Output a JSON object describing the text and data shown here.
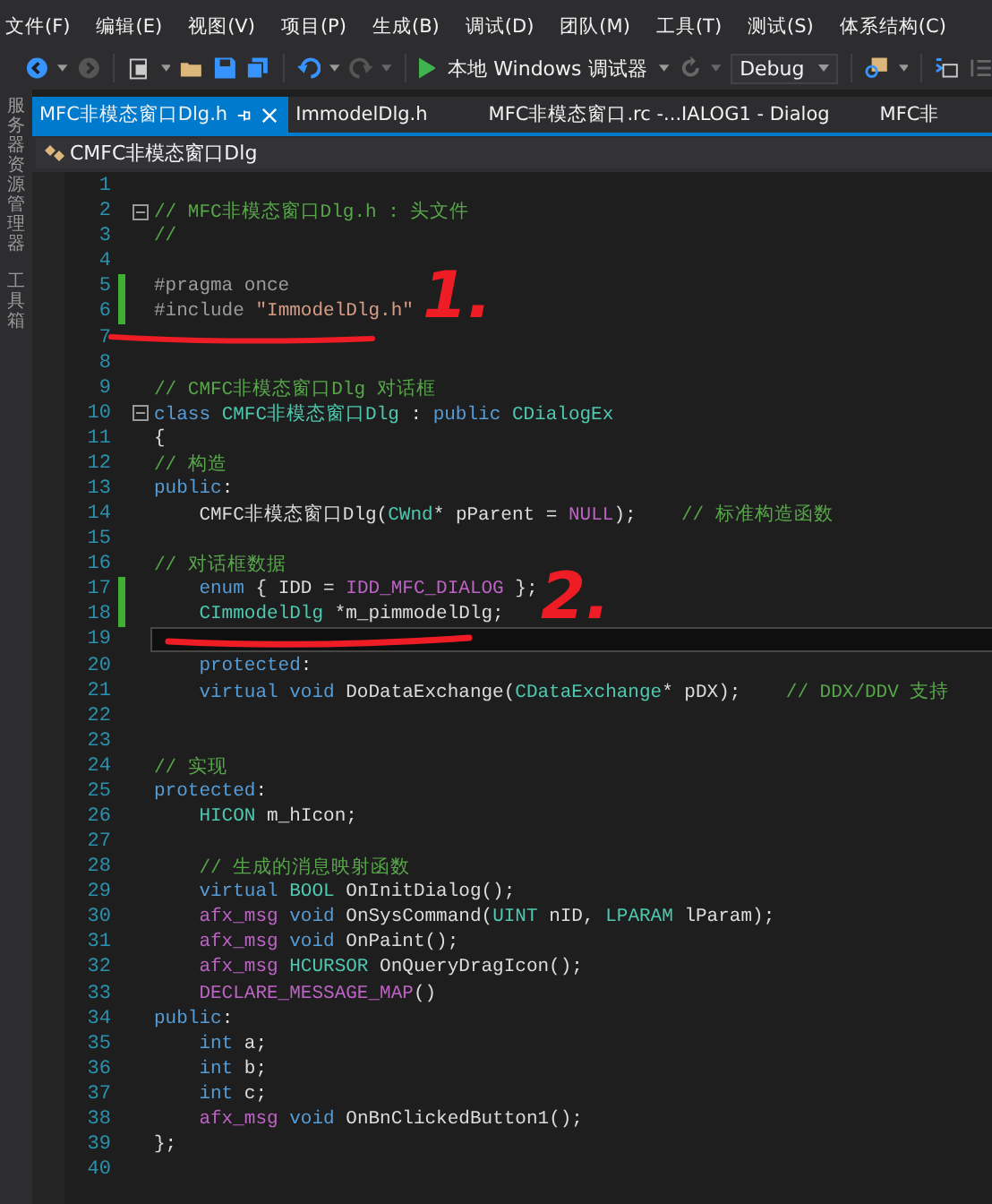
{
  "menu": [
    "文件(F)",
    "编辑(E)",
    "视图(V)",
    "项目(P)",
    "生成(B)",
    "调试(D)",
    "团队(M)",
    "工具(T)",
    "测试(S)",
    "体系结构(C)"
  ],
  "toolbar": {
    "debugger": "本地 Windows 调试器",
    "configuration": "Debug"
  },
  "side_panels": [
    "服务器资源管理器",
    "工具箱"
  ],
  "tabs": [
    {
      "label": "MFC非模态窗口Dlg.h",
      "selected": true
    },
    {
      "label": "ImmodelDlg.h",
      "selected": false
    },
    {
      "label": "MFC非模态窗口.rc -...IALOG1 - Dialog",
      "selected": false
    },
    {
      "label": "MFC非",
      "selected": false
    }
  ],
  "navigation": {
    "class": "CMFC非模态窗口Dlg"
  },
  "lines": [
    {
      "number": "1",
      "changed": false,
      "current": false,
      "fold": false
    },
    {
      "number": "2",
      "changed": false,
      "current": false,
      "fold": true,
      "tokens": [
        {
          "kind": "comment",
          "text": "// MFC非模态窗口Dlg.h : 头文件"
        }
      ]
    },
    {
      "number": "3",
      "changed": false,
      "current": false,
      "fold": false,
      "tokens": [
        {
          "kind": "comment",
          "text": "//"
        }
      ]
    },
    {
      "number": "4",
      "changed": false,
      "current": false,
      "fold": false
    },
    {
      "number": "5",
      "changed": true,
      "current": false,
      "fold": false,
      "tokens": [
        {
          "kind": "preprocessor",
          "text": "#pragma once"
        }
      ]
    },
    {
      "number": "6",
      "changed": true,
      "current": false,
      "fold": false,
      "tokens": [
        {
          "kind": "preprocessor",
          "text": "#include "
        },
        {
          "kind": "string",
          "text": "\"ImmodelDlg.h\""
        }
      ]
    },
    {
      "number": "7",
      "changed": false,
      "current": false,
      "fold": false
    },
    {
      "number": "8",
      "changed": false,
      "current": false,
      "fold": false
    },
    {
      "number": "9",
      "changed": false,
      "current": false,
      "fold": false,
      "tokens": [
        {
          "kind": "comment",
          "text": "// CMFC非模态窗口Dlg 对话框"
        }
      ]
    },
    {
      "number": "10",
      "changed": false,
      "current": false,
      "fold": true,
      "tokens": [
        {
          "kind": "keyword",
          "text": "class "
        },
        {
          "kind": "type",
          "text": "CMFC非模态窗口Dlg"
        },
        {
          "kind": "plain",
          "text": " : "
        },
        {
          "kind": "keyword",
          "text": "public "
        },
        {
          "kind": "type",
          "text": "CDialogEx"
        }
      ]
    },
    {
      "number": "11",
      "changed": false,
      "current": false,
      "fold": false,
      "tokens": [
        {
          "kind": "plain",
          "text": "{"
        }
      ]
    },
    {
      "number": "12",
      "changed": false,
      "current": false,
      "fold": false,
      "tokens": [
        {
          "kind": "comment",
          "text": "// 构造"
        }
      ]
    },
    {
      "number": "13",
      "changed": false,
      "current": false,
      "fold": false,
      "tokens": [
        {
          "kind": "keyword",
          "text": "public"
        },
        {
          "kind": "plain",
          "text": ":"
        }
      ]
    },
    {
      "number": "14",
      "changed": false,
      "current": false,
      "fold": false,
      "tokens": [
        {
          "kind": "plain",
          "text": "    CMFC非模态窗口Dlg("
        },
        {
          "kind": "type",
          "text": "CWnd"
        },
        {
          "kind": "plain",
          "text": "* pParent = "
        },
        {
          "kind": "macro",
          "text": "NULL"
        },
        {
          "kind": "plain",
          "text": ");    "
        },
        {
          "kind": "comment",
          "text": "// 标准构造函数"
        }
      ]
    },
    {
      "number": "15",
      "changed": false,
      "current": false,
      "fold": false
    },
    {
      "number": "16",
      "changed": false,
      "current": false,
      "fold": false,
      "tokens": [
        {
          "kind": "comment",
          "text": "// 对话框数据"
        }
      ]
    },
    {
      "number": "17",
      "changed": true,
      "current": false,
      "fold": false,
      "tokens": [
        {
          "kind": "keyword",
          "text": "    enum"
        },
        {
          "kind": "plain",
          "text": " { IDD = "
        },
        {
          "kind": "macro",
          "text": "IDD_MFC_DIALOG"
        },
        {
          "kind": "plain",
          "text": " };"
        }
      ]
    },
    {
      "number": "18",
      "changed": true,
      "current": false,
      "fold": false,
      "tokens": [
        {
          "kind": "type",
          "text": "    CImmodelDlg"
        },
        {
          "kind": "plain",
          "text": " *m_pimmodelDlg;"
        }
      ]
    },
    {
      "number": "19",
      "changed": false,
      "current": true,
      "fold": false
    },
    {
      "number": "20",
      "changed": false,
      "current": false,
      "fold": false,
      "tokens": [
        {
          "kind": "keyword",
          "text": "    protected"
        },
        {
          "kind": "plain",
          "text": ":"
        }
      ]
    },
    {
      "number": "21",
      "changed": false,
      "current": false,
      "fold": false,
      "tokens": [
        {
          "kind": "keyword",
          "text": "    virtual void"
        },
        {
          "kind": "plain",
          "text": " DoDataExchange("
        },
        {
          "kind": "type",
          "text": "CDataExchange"
        },
        {
          "kind": "plain",
          "text": "* pDX);    "
        },
        {
          "kind": "comment",
          "text": "// DDX/DDV 支持"
        }
      ]
    },
    {
      "number": "22",
      "changed": false,
      "current": false,
      "fold": false
    },
    {
      "number": "23",
      "changed": false,
      "current": false,
      "fold": false
    },
    {
      "number": "24",
      "changed": false,
      "current": false,
      "fold": false,
      "tokens": [
        {
          "kind": "comment",
          "text": "// 实现"
        }
      ]
    },
    {
      "number": "25",
      "changed": false,
      "current": false,
      "fold": false,
      "tokens": [
        {
          "kind": "keyword",
          "text": "protected"
        },
        {
          "kind": "plain",
          "text": ":"
        }
      ]
    },
    {
      "number": "26",
      "changed": false,
      "current": false,
      "fold": false,
      "tokens": [
        {
          "kind": "type",
          "text": "    HICON"
        },
        {
          "kind": "plain",
          "text": " m_hIcon;"
        }
      ]
    },
    {
      "number": "27",
      "changed": false,
      "current": false,
      "fold": false
    },
    {
      "number": "28",
      "changed": false,
      "current": false,
      "fold": false,
      "tokens": [
        {
          "kind": "comment",
          "text": "    // 生成的消息映射函数"
        }
      ]
    },
    {
      "number": "29",
      "changed": false,
      "current": false,
      "fold": false,
      "tokens": [
        {
          "kind": "keyword",
          "text": "    virtual "
        },
        {
          "kind": "type",
          "text": "BOOL"
        },
        {
          "kind": "plain",
          "text": " OnInitDialog();"
        }
      ]
    },
    {
      "number": "30",
      "changed": false,
      "current": false,
      "fold": false,
      "tokens": [
        {
          "kind": "macro",
          "text": "    afx_msg "
        },
        {
          "kind": "keyword",
          "text": "void"
        },
        {
          "kind": "plain",
          "text": " OnSysCommand("
        },
        {
          "kind": "type",
          "text": "UINT"
        },
        {
          "kind": "plain",
          "text": " nID, "
        },
        {
          "kind": "type",
          "text": "LPARAM"
        },
        {
          "kind": "plain",
          "text": " lParam);"
        }
      ]
    },
    {
      "number": "31",
      "changed": false,
      "current": false,
      "fold": false,
      "tokens": [
        {
          "kind": "macro",
          "text": "    afx_msg "
        },
        {
          "kind": "keyword",
          "text": "void"
        },
        {
          "kind": "plain",
          "text": " OnPaint();"
        }
      ]
    },
    {
      "number": "32",
      "changed": false,
      "current": false,
      "fold": false,
      "tokens": [
        {
          "kind": "macro",
          "text": "    afx_msg "
        },
        {
          "kind": "type",
          "text": "HCURSOR"
        },
        {
          "kind": "plain",
          "text": " OnQueryDragIcon();"
        }
      ]
    },
    {
      "number": "33",
      "changed": false,
      "current": false,
      "fold": false,
      "tokens": [
        {
          "kind": "macro",
          "text": "    DECLARE_MESSAGE_MAP"
        },
        {
          "kind": "plain",
          "text": "()"
        }
      ]
    },
    {
      "number": "34",
      "changed": false,
      "current": false,
      "fold": false,
      "tokens": [
        {
          "kind": "keyword",
          "text": "public"
        },
        {
          "kind": "plain",
          "text": ":"
        }
      ]
    },
    {
      "number": "35",
      "changed": false,
      "current": false,
      "fold": false,
      "tokens": [
        {
          "kind": "keyword",
          "text": "    int"
        },
        {
          "kind": "plain",
          "text": " a;"
        }
      ]
    },
    {
      "number": "36",
      "changed": false,
      "current": false,
      "fold": false,
      "tokens": [
        {
          "kind": "keyword",
          "text": "    int"
        },
        {
          "kind": "plain",
          "text": " b;"
        }
      ]
    },
    {
      "number": "37",
      "changed": false,
      "current": false,
      "fold": false,
      "tokens": [
        {
          "kind": "keyword",
          "text": "    int"
        },
        {
          "kind": "plain",
          "text": " c;"
        }
      ]
    },
    {
      "number": "38",
      "changed": false,
      "current": false,
      "fold": false,
      "tokens": [
        {
          "kind": "macro",
          "text": "    afx_msg "
        },
        {
          "kind": "keyword",
          "text": "void"
        },
        {
          "kind": "plain",
          "text": " OnBnClickedButton1();"
        }
      ]
    },
    {
      "number": "39",
      "changed": false,
      "current": false,
      "fold": false,
      "tokens": [
        {
          "kind": "plain",
          "text": "};"
        }
      ]
    },
    {
      "number": "40",
      "changed": false,
      "current": false,
      "fold": false
    }
  ],
  "annotations": [
    "1.",
    "2."
  ]
}
